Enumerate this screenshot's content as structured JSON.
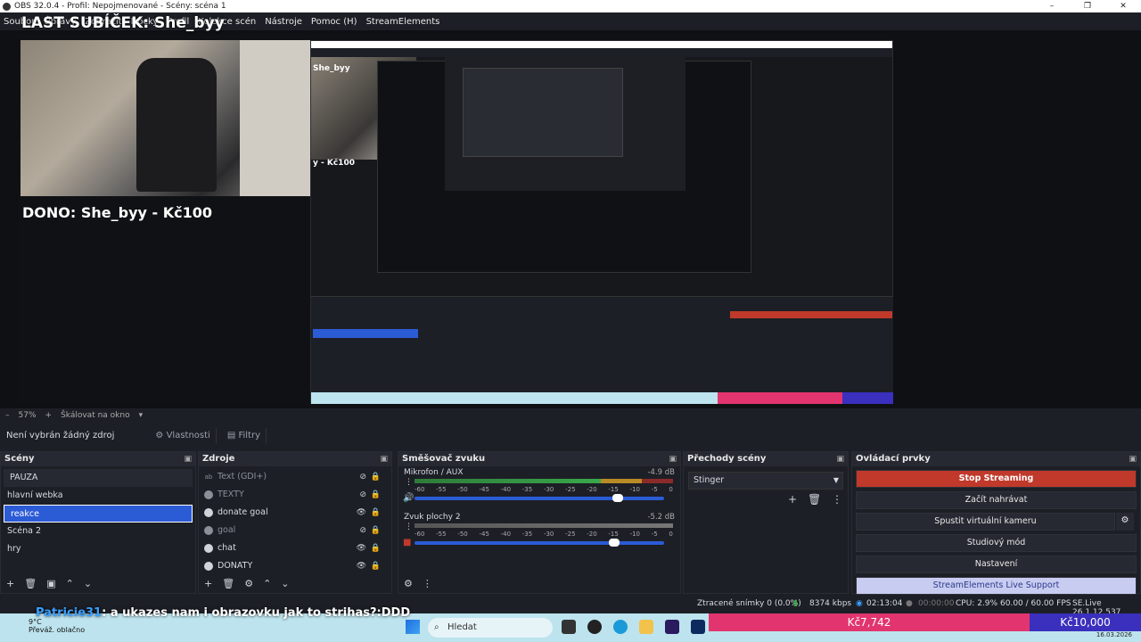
{
  "window": {
    "title": "OBS 32.0.4 - Profil: Nepojmenované - Scény: scéna 1",
    "controls": [
      "–",
      "❐",
      "✕"
    ]
  },
  "menu": [
    "Soubor",
    "Úpravy",
    "Zobrazit",
    "Docky",
    "Profil",
    "Kolekce scén",
    "Nástroje",
    "Pomoc (H)",
    "StreamElements"
  ],
  "preview": {
    "overlay_title": "LAST SUBÍČEK: She_byy",
    "overlay_dono": "DONO: She_byy - Kč100",
    "nested_label_1": "She_byy",
    "nested_label_2": "y - Kč100",
    "nested_label_3": "Kč100"
  },
  "zoom": {
    "minus": "–",
    "level": "57%",
    "plus": "+",
    "scale_mode": "Škálovat na okno",
    "arrow": "▾"
  },
  "properties_bar": {
    "no_source": "Není vybrán žádný zdroj",
    "properties": "Vlastnosti",
    "filters": "Filtry"
  },
  "scenes": {
    "title": "Scény",
    "items": [
      "PAUZA",
      "hlavní webka",
      "reakce",
      "Scéna 2",
      "hry"
    ],
    "active_index": 2,
    "footer": [
      "+",
      "🗑",
      "▣",
      "⌃",
      "⌄"
    ]
  },
  "sources": {
    "title": "Zdroje",
    "items": [
      {
        "label": "Text (GDI+)",
        "dim": true
      },
      {
        "label": "TEXTY",
        "dim": true
      },
      {
        "label": "donate goal",
        "dim": false
      },
      {
        "label": "goal",
        "dim": true
      },
      {
        "label": "chat",
        "dim": false
      },
      {
        "label": "DONATY",
        "dim": false
      }
    ],
    "footer": [
      "+",
      "🗑",
      "⚙",
      "⌃",
      "⌄"
    ]
  },
  "mixer": {
    "title": "Směšovač zvuku",
    "channels": [
      {
        "name": "Mikrofon / AUX",
        "db": "-4.9 dB",
        "volume": 0.8
      },
      {
        "name": "Zvuk plochy 2",
        "db": "-5.2 dB",
        "volume": 0.78
      }
    ],
    "scale": [
      "-60",
      "-55",
      "-50",
      "-45",
      "-40",
      "-35",
      "-30",
      "-25",
      "-20",
      "-15",
      "-10",
      "-5",
      "0"
    ],
    "footer": [
      "⚙",
      "⋮"
    ]
  },
  "transitions": {
    "title": "Přechody scény",
    "selected": "Stinger",
    "buttons": [
      "+",
      "🗑",
      "⋮"
    ]
  },
  "controls": {
    "title": "Ovládací prvky",
    "stop_streaming": "Stop Streaming",
    "start_recording": "Začít nahrávat",
    "virtual_camera": "Spustit virtuální kameru",
    "studio_mode": "Studiový mód",
    "settings": "Nastavení",
    "se_support": "StreamElements Live Support"
  },
  "status": {
    "dropped": "Ztracené snímky 0 (0.0%)",
    "bitrate": "8374 kbps",
    "stream_time": "02:13:04",
    "rec_time": "00:00:00",
    "cpu": "CPU: 2.9%",
    "fps": "60.00 / 60.00 FPS",
    "version": "SE.Live 26.1.12.537"
  },
  "chat_overlay": {
    "user": "Patricie31",
    "message": ": a ukazes nam i obrazovku jak to strihas?:DDD"
  },
  "donation_bar": {
    "left": "Kč7,742",
    "right": "Kč10,000"
  },
  "taskbar": {
    "temp": "9°C",
    "weather": "Převáž. oblačno",
    "search": "Hledat",
    "date": "16.03.2026"
  },
  "colors": {
    "accent_blue": "#2c5bd6",
    "stop_red": "#c0392b",
    "donate_pink": "#e2356f",
    "donate_purple": "#3b2fbe"
  }
}
